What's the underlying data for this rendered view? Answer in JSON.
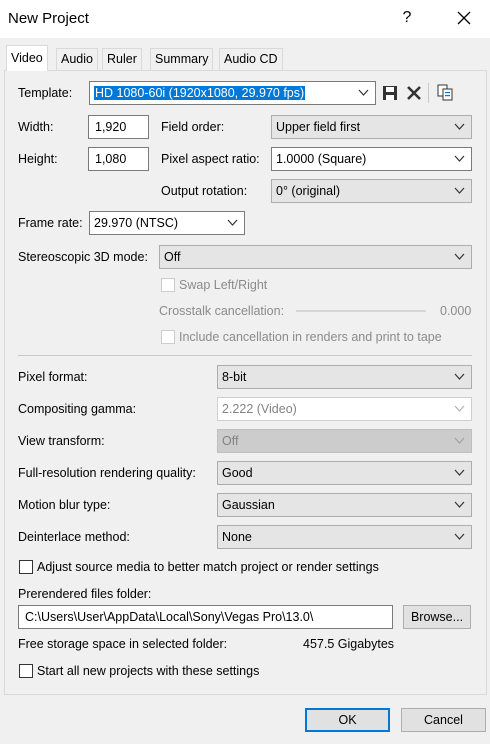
{
  "window": {
    "title": "New Project",
    "help": "?"
  },
  "tabs": [
    "Video",
    "Audio",
    "Ruler",
    "Summary",
    "Audio CD"
  ],
  "video": {
    "template_label": "Template:",
    "template_value": "HD 1080-60i (1920x1080, 29.970 fps)",
    "width_label": "Width:",
    "width_value": "1,920",
    "height_label": "Height:",
    "height_value": "1,080",
    "field_order_label": "Field order:",
    "field_order_value": "Upper field first",
    "pixel_aspect_label": "Pixel aspect ratio:",
    "pixel_aspect_value": "1.0000 (Square)",
    "output_rotation_label": "Output rotation:",
    "output_rotation_value": "0° (original)",
    "frame_rate_label": "Frame rate:",
    "frame_rate_value": "29.970 (NTSC)",
    "stereo_label": "Stereoscopic 3D mode:",
    "stereo_value": "Off",
    "swap_label": "Swap Left/Right",
    "crosstalk_label": "Crosstalk cancellation:",
    "crosstalk_value": "0.000",
    "include_cancel_label": "Include cancellation in renders and print to tape",
    "pixel_format_label": "Pixel format:",
    "pixel_format_value": "8-bit",
    "gamma_label": "Compositing gamma:",
    "gamma_value": "2.222 (Video)",
    "view_transform_label": "View transform:",
    "view_transform_value": "Off",
    "full_res_label": "Full-resolution rendering quality:",
    "full_res_value": "Good",
    "motion_blur_label": "Motion blur type:",
    "motion_blur_value": "Gaussian",
    "deinterlace_label": "Deinterlace method:",
    "deinterlace_value": "None",
    "adjust_source_label": "Adjust source media to better match project or render settings",
    "prerendered_label": "Prerendered files folder:",
    "prerendered_value": "C:\\Users\\User\\AppData\\Local\\Sony\\Vegas Pro\\13.0\\",
    "browse_label": "Browse...",
    "free_space_label": "Free storage space in selected folder:",
    "free_space_value": "457.5 Gigabytes",
    "start_all_label": "Start all new projects with these settings"
  },
  "footer": {
    "ok_label": "OK",
    "cancel_label": "Cancel"
  },
  "colors": {
    "accent": "#0078d7",
    "disabled_text": "#8b8b8b"
  },
  "icons": [
    "save-icon",
    "delete-icon",
    "copy-template-icon",
    "close-icon",
    "chevron-down-icon"
  ]
}
